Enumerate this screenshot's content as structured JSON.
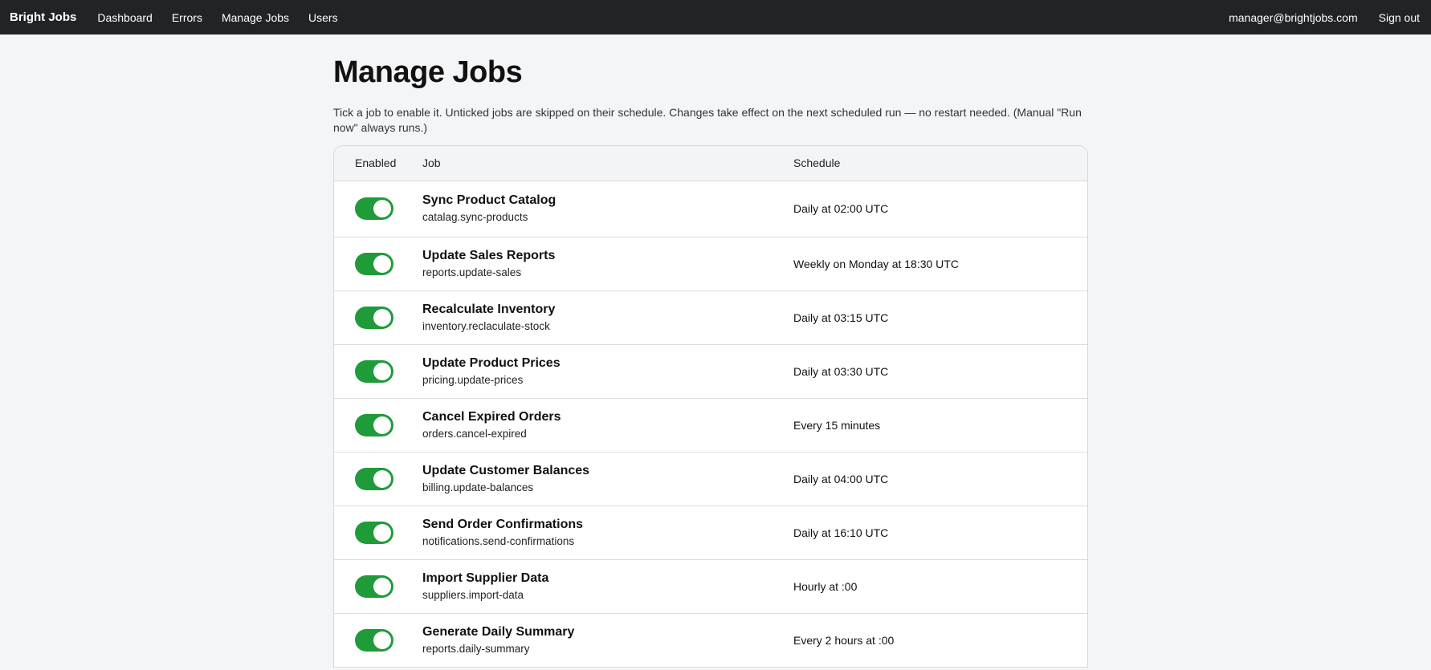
{
  "nav": {
    "brand": "Bright Jobs",
    "links": [
      "Dashboard",
      "Errors",
      "Manage Jobs",
      "Users"
    ],
    "email": "manager@brightjobs.com",
    "signout": "Sign out"
  },
  "page": {
    "title": "Manage Jobs",
    "description": "Tick a job to enable it. Unticked jobs are skipped on their schedule. Changes take effect on the next scheduled run — no restart needed. (Manual \"Run now\" always runs.)"
  },
  "table": {
    "headers": [
      "Enabled",
      "Job",
      "Schedule"
    ],
    "rows": [
      {
        "enabled": true,
        "name": "Sync Product Catalog",
        "key": "catalag.sync-products",
        "schedule": "Daily at 02:00 UTC"
      },
      {
        "enabled": true,
        "name": "Update Sales Reports",
        "key": "reports.update-sales",
        "schedule": "Weekly on Monday at 18:30 UTC"
      },
      {
        "enabled": true,
        "name": "Recalculate Inventory",
        "key": "inventory.reclaculate-stock",
        "schedule": "Daily at 03:15 UTC"
      },
      {
        "enabled": true,
        "name": "Update Product Prices",
        "key": "pricing.update-prices",
        "schedule": "Daily at 03:30 UTC"
      },
      {
        "enabled": true,
        "name": "Cancel Expired Orders",
        "key": "orders.cancel-expired",
        "schedule": "Every 15 minutes"
      },
      {
        "enabled": true,
        "name": "Update Customer Balances",
        "key": "billing.update-balances",
        "schedule": "Daily at 04:00 UTC"
      },
      {
        "enabled": true,
        "name": "Send Order Confirmations",
        "key": "notifications.send-confirmations",
        "schedule": "Daily at 16:10 UTC"
      },
      {
        "enabled": true,
        "name": "Import Supplier Data",
        "key": "suppliers.import-data",
        "schedule": "Hourly at :00"
      },
      {
        "enabled": true,
        "name": "Generate Daily Summary",
        "key": "reports.daily-summary",
        "schedule": "Every 2 hours at :00"
      }
    ]
  },
  "colors": {
    "navbar_bg": "#212326",
    "toggle_on": "#1f9b3a",
    "page_bg": "#f4f5f7"
  }
}
